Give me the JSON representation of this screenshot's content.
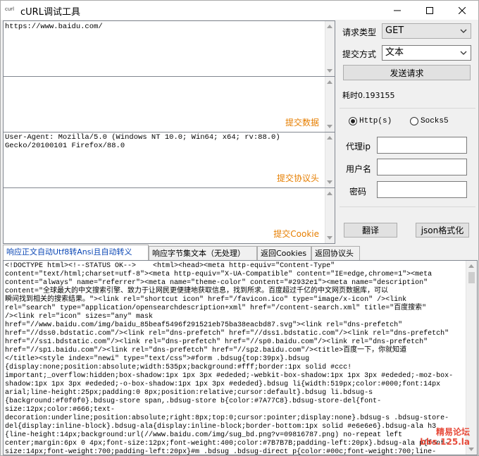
{
  "window": {
    "title": "cURL调试工具",
    "app_icon_text": "curl"
  },
  "inputs": {
    "url_value": "https://www.baidu.com/",
    "post_data_value": "",
    "headers_value": "User-Agent: Mozilla/5.0 (Windows NT 10.0; Win64; x64; rv:88.0)\nGecko/20100101 Firefox/88.0",
    "cookie_value": "",
    "labels": {
      "post_data": "提交数据",
      "headers": "提交协议头",
      "cookie": "提交Cookie"
    }
  },
  "right_panel": {
    "request_type_label": "请求类型",
    "request_type_value": "GET",
    "submit_mode_label": "提交方式",
    "submit_mode_value": "文本",
    "send_button": "发送请求",
    "elapsed_text": "耗时0.193155",
    "proxy_http_label": "Http(s)",
    "proxy_socks_label": "Socks5",
    "proxy_ip_label": "代理ip",
    "username_label": "用户名",
    "password_label": "密码",
    "translate_button": "翻译",
    "json_button": "json格式化"
  },
  "tabs": [
    {
      "label": "响应正文自动Utf8转Ansi且自动转义"
    },
    {
      "label": "响应字节集文本（无处理）"
    },
    {
      "label": "返回Cookies"
    },
    {
      "label": "返回协议头"
    }
  ],
  "response": {
    "body": "<!DOCTYPE html><!--STATUS OK-->    <html><head><meta http-equiv=\"Content-Type\"\ncontent=\"text/html;charset=utf-8\"><meta http-equiv=\"X-UA-Compatible\" content=\"IE=edge,chrome=1\"><meta\ncontent=\"always\" name=\"referrer\"><meta name=\"theme-color\" content=\"#2932e1\"><meta name=\"description\"\ncontent=\"全球最大的中文搜索引擎、致力于让网民更便捷地获取信息，找到所求。百度超过千亿的中文网页数据库，可以\n瞬间找到相关的搜索结果。\"><link rel=\"shortcut icon\" href=\"/favicon.ico\" type=\"image/x-icon\" /><link\nrel=\"search\" type=\"application/opensearchdescription+xml\" href=\"/content-search.xml\" title=\"百度搜索\"\n/><link rel=\"icon\" sizes=\"any\" mask\nhref=\"//www.baidu.com/img/baidu_85beaf5496f291521eb75ba38eacbd87.svg\"><link rel=\"dns-prefetch\"\nhref=\"//dss0.bdstatic.com\"/><link rel=\"dns-prefetch\" href=\"//dss1.bdstatic.com\"/><link rel=\"dns-prefetch\"\nhref=\"//ss1.bdstatic.com\"/><link rel=\"dns-prefetch\" href=\"//sp0.baidu.com\"/><link rel=\"dns-prefetch\"\nhref=\"//sp1.baidu.com\"/><link rel=\"dns-prefetch\" href=\"//sp2.baidu.com\"/><title>百度一下，你就知道\n</title><style index=\"newi\" type=\"text/css\">#form .bdsug{top:39px}.bdsug\n{display:none;position:absolute;width:535px;background:#fff;border:1px solid #ccc!\nimportant;_overflow:hidden;box-shadow:1px 1px 3px #ededed;-webkit-box-shadow:1px 1px 3px #ededed;-moz-box-\nshadow:1px 1px 3px #ededed;-o-box-shadow:1px 1px 3px #ededed}.bdsug li{width:519px;color:#000;font:14px\narial;line-height:25px;padding:0 8px;position:relative;cursor:default}.bdsug li.bdsug-s\n{background:#f0f0f0}.bdsug-store span,.bdsug-store b{color:#7A77C8}.bdsug-store-del{font-\nsize:12px;color:#666;text-\ndecoration:underline;position:absolute;right:8px;top:0;cursor:pointer;display:none}.bdsug-s .bdsug-store-\ndel{display:inline-block}.bdsug-ala{display:inline-block;border-bottom:1px solid #e6e6e6}.bdsug-ala h3\n{line-height:14px;background:url(//www.baidu.com/img/sug_bd.png?v=09816787.png) no-repeat left\ncenter;margin:6px 0 4px;font-size:12px;font-weight:400;color:#7B7B7B;padding-left:20px}.bdsug-ala p{font-\nsize:14px;font-weight:700;padding-left:20px}#m .bdsug .bdsug-direct p{color:#00c;font-weight:700;line-"
  },
  "watermark": {
    "line1": "精易论坛",
    "line2": "bbs.125.la"
  },
  "colors": {
    "accent_orange": "#e67e00",
    "active_tab_text": "#0a46b4"
  }
}
